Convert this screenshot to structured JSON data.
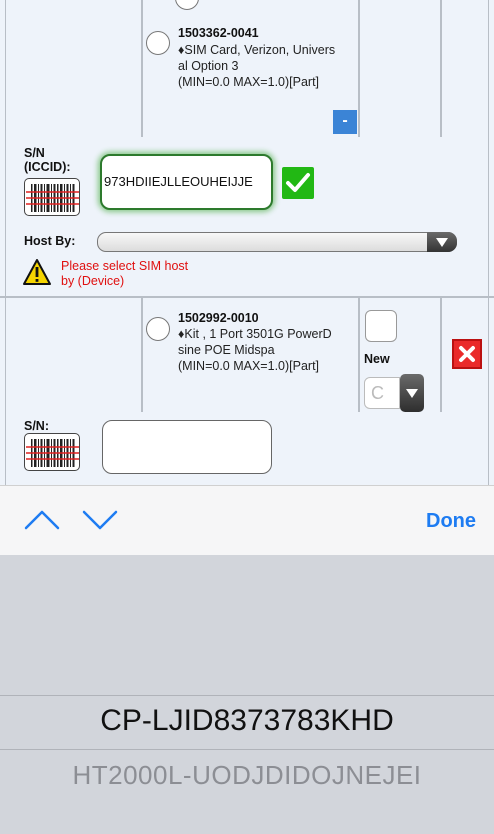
{
  "items": [
    {
      "part_number": "1503362-0041",
      "description": "♦SIM Card, Verizon, Univers\nal Option 3\n(MIN=0.0 MAX=1.0)[Part]",
      "collapse_button_label": "-",
      "sn_label": "S/N\n(ICCID):",
      "sn_value": "973HDIIEJLLEOUHEIJJE",
      "host_label": "Host By:",
      "host_selected": "",
      "warning_text": "Please select SIM host\nby (Device)"
    },
    {
      "part_number": "1502992-0010",
      "description": "♦Kit , 1 Port 3501G PowerD\nsine POE Midspa\n(MIN=0.0 MAX=1.0)[Part]",
      "condition_label": "New",
      "condition_value": "C",
      "sn_label": "S/N:",
      "sn_value": ""
    }
  ],
  "accessory": {
    "prev_icon": "chevron-up-icon",
    "next_icon": "chevron-down-icon",
    "done_label": "Done"
  },
  "picker": {
    "selected": "CP-LJID8373783KHD",
    "next": "HT2000L-UODJDIDOJNEJEI"
  },
  "colors": {
    "accent": "#1e7cf2",
    "valid": "#22b814",
    "warning_text": "#e01010",
    "delete": "#ea2a2a",
    "form_bg": "#eef3fa",
    "picker_bg": "#d2d5db"
  }
}
